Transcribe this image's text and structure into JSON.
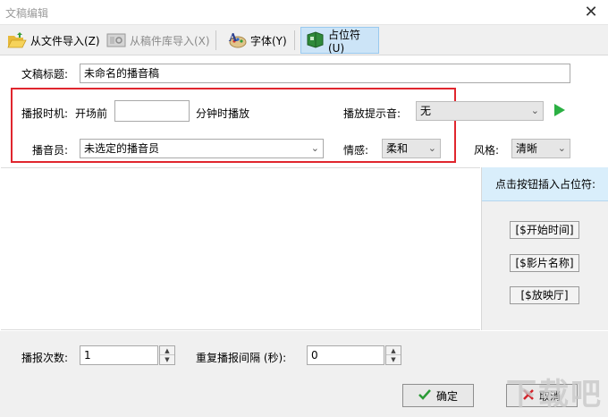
{
  "window": {
    "title": "文稿编辑",
    "close_glyph": "✕"
  },
  "toolbar": {
    "import_file": "从文件导入(Z)",
    "import_library": "从稿件库导入(X)",
    "font": "字体(Y)",
    "placeholder": "占位符(U)"
  },
  "form": {
    "title_label": "文稿标题:",
    "title_value": "未命名的播音稿",
    "time_label": "播报时机:",
    "before_label": "开场前",
    "minutes_value": "",
    "after_label": "分钟时播放",
    "tone_label": "播放提示音:",
    "tone_value": "无",
    "announcer_label": "播音员:",
    "announcer_value": "未选定的播音员",
    "emotion_label": "情感:",
    "emotion_value": "柔和",
    "style_label": "风格:",
    "style_value": "清晰"
  },
  "side": {
    "header": "点击按钮插入占位符:",
    "buttons": [
      "[$开始时间]",
      "[$影片名称]",
      "[$放映厅]"
    ]
  },
  "bottom": {
    "count_label": "播报次数:",
    "count_value": "1",
    "interval_label": "重复播报间隔 (秒):",
    "interval_value": "0",
    "ok": "确定",
    "cancel": "取消"
  },
  "colors": {
    "highlight_border": "#e0262e",
    "play_icon": "#2bb043",
    "side_header": "#d9eefb"
  },
  "watermark": "下载吧"
}
